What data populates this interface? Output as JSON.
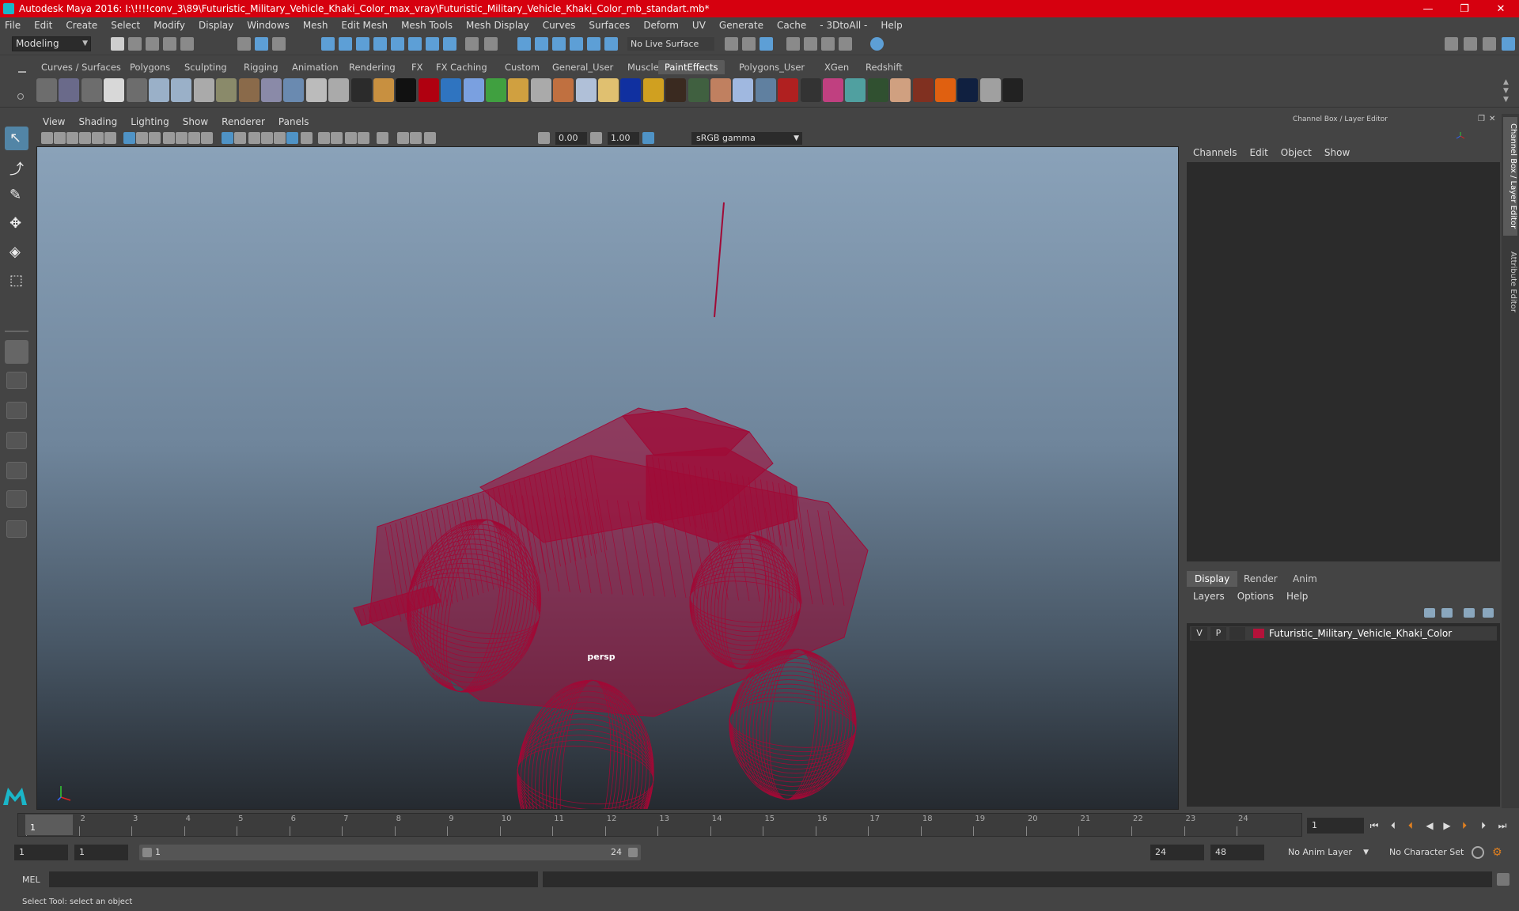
{
  "window": {
    "title": "Autodesk Maya 2016: I:\\!!!!conv_3\\89\\Futuristic_Military_Vehicle_Khaki_Color_max_vray\\Futuristic_Military_Vehicle_Khaki_Color_mb_standart.mb*",
    "minimize": "—",
    "restore": "❐",
    "close": "✕"
  },
  "menu": [
    "File",
    "Edit",
    "Create",
    "Select",
    "Modify",
    "Display",
    "Windows",
    "Mesh",
    "Edit Mesh",
    "Mesh Tools",
    "Mesh Display",
    "Curves",
    "Surfaces",
    "Deform",
    "UV",
    "Generate",
    "Cache",
    "- 3DtoAll -",
    "Help"
  ],
  "status": {
    "mode": "Modeling",
    "live_surface": "No Live Surface"
  },
  "shelf_tabs": [
    "Curves / Surfaces",
    "Polygons",
    "Sculpting",
    "Rigging",
    "Animation",
    "Rendering",
    "FX",
    "FX Caching",
    "Custom",
    "General_User",
    "Muscle",
    "PaintEffects",
    "Polygons_User",
    "XGen",
    "Redshift"
  ],
  "shelf_active": "PaintEffects",
  "viewport": {
    "menu": [
      "View",
      "Shading",
      "Lighting",
      "Show",
      "Renderer",
      "Panels"
    ],
    "exposure": "0.00",
    "gamma": "1.00",
    "color_space": "sRGB gamma",
    "camera": "persp",
    "wire_color": "#a00a36"
  },
  "channel_box": {
    "title": "Channel Box / Layer Editor",
    "menu": [
      "Channels",
      "Edit",
      "Object",
      "Show"
    ]
  },
  "layer_editor": {
    "tabs": [
      "Display",
      "Render",
      "Anim"
    ],
    "menu": [
      "Layers",
      "Options",
      "Help"
    ],
    "layer": {
      "v": "V",
      "p": "P",
      "name": "Futuristic_Military_Vehicle_Khaki_Color",
      "color": "#b5123a"
    }
  },
  "side_tabs": [
    "Channel Box / Layer Editor",
    "Attribute Editor"
  ],
  "timeline": {
    "ticks": [
      "1",
      "2",
      "3",
      "4",
      "5",
      "6",
      "7",
      "8",
      "9",
      "10",
      "11",
      "12",
      "13",
      "14",
      "15",
      "16",
      "17",
      "18",
      "19",
      "20",
      "21",
      "22",
      "23",
      "24"
    ],
    "current_frame": "1",
    "current_field": "1"
  },
  "range": {
    "start": "1",
    "playback_start": "1",
    "handle_start": "1",
    "handle_end": "24",
    "end": "24",
    "anim_end": "48",
    "anim_layer": "No Anim Layer",
    "character_set": "No Character Set"
  },
  "command": {
    "label": "MEL"
  },
  "help_line": "Select Tool: select an object"
}
